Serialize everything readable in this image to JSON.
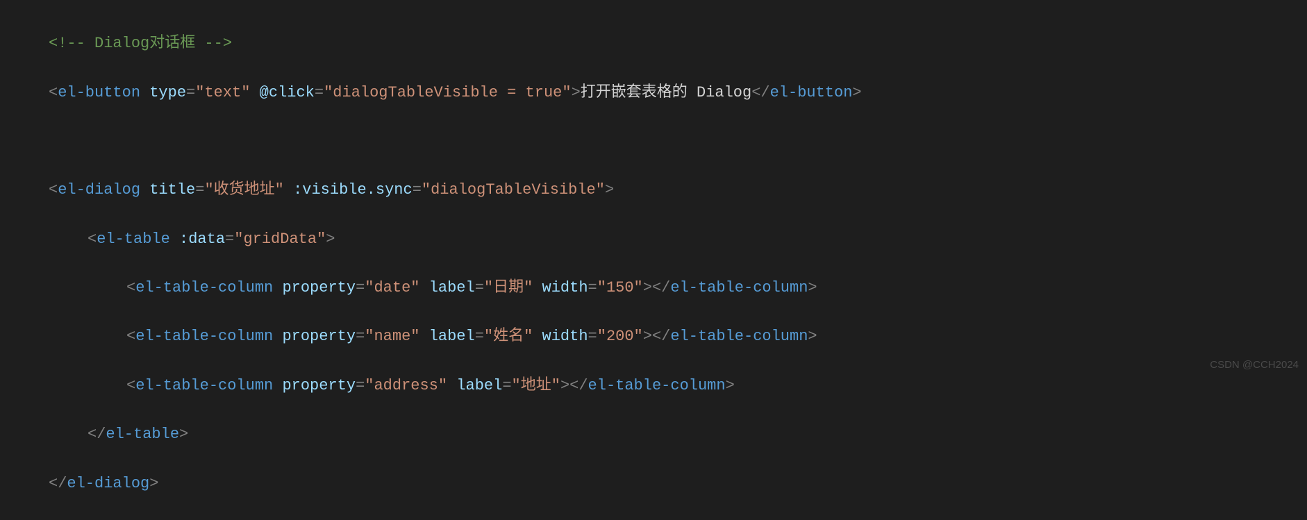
{
  "code": {
    "line1": {
      "comment_open": "<!-- ",
      "comment_text": "Dialog对话框",
      "comment_close": " -->"
    },
    "line2": {
      "open_bracket": "<",
      "tag": "el-button",
      "attr1_name": "type",
      "attr1_value": "\"text\"",
      "attr2_name": "@click",
      "attr2_value": "\"dialogTableVisible = true\"",
      "close_bracket": ">",
      "content": "打开嵌套表格的 Dialog",
      "close_open": "</",
      "close_tag": "el-button",
      "close_close": ">"
    },
    "line4": {
      "open_bracket": "<",
      "tag": "el-dialog",
      "attr1_name": "title",
      "attr1_value": "\"收货地址\"",
      "attr2_name": ":visible.sync",
      "attr2_value": "\"dialogTableVisible\"",
      "close_bracket": ">"
    },
    "line5": {
      "open_bracket": "<",
      "tag": "el-table",
      "attr1_name": ":data",
      "attr1_value": "\"gridData\"",
      "close_bracket": ">"
    },
    "line6": {
      "open_bracket": "<",
      "tag": "el-table-column",
      "attr1_name": "property",
      "attr1_value": "\"date\"",
      "attr2_name": "label",
      "attr2_value": "\"日期\"",
      "attr3_name": "width",
      "attr3_value": "\"150\"",
      "close_bracket": ">",
      "close_open": "</",
      "close_tag": "el-table-column",
      "close_close": ">"
    },
    "line7": {
      "open_bracket": "<",
      "tag": "el-table-column",
      "attr1_name": "property",
      "attr1_value": "\"name\"",
      "attr2_name": "label",
      "attr2_value": "\"姓名\"",
      "attr3_name": "width",
      "attr3_value": "\"200\"",
      "close_bracket": ">",
      "close_open": "</",
      "close_tag": "el-table-column",
      "close_close": ">"
    },
    "line8": {
      "open_bracket": "<",
      "tag": "el-table-column",
      "attr1_name": "property",
      "attr1_value": "\"address\"",
      "attr2_name": "label",
      "attr2_value": "\"地址\"",
      "close_bracket": ">",
      "close_open": "</",
      "close_tag": "el-table-column",
      "close_close": ">"
    },
    "line9": {
      "close_open": "</",
      "close_tag": "el-table",
      "close_close": ">"
    },
    "line10": {
      "close_open": "</",
      "close_tag": "el-dialog",
      "close_close": ">"
    }
  },
  "watermark": "CSDN @CCH2024"
}
